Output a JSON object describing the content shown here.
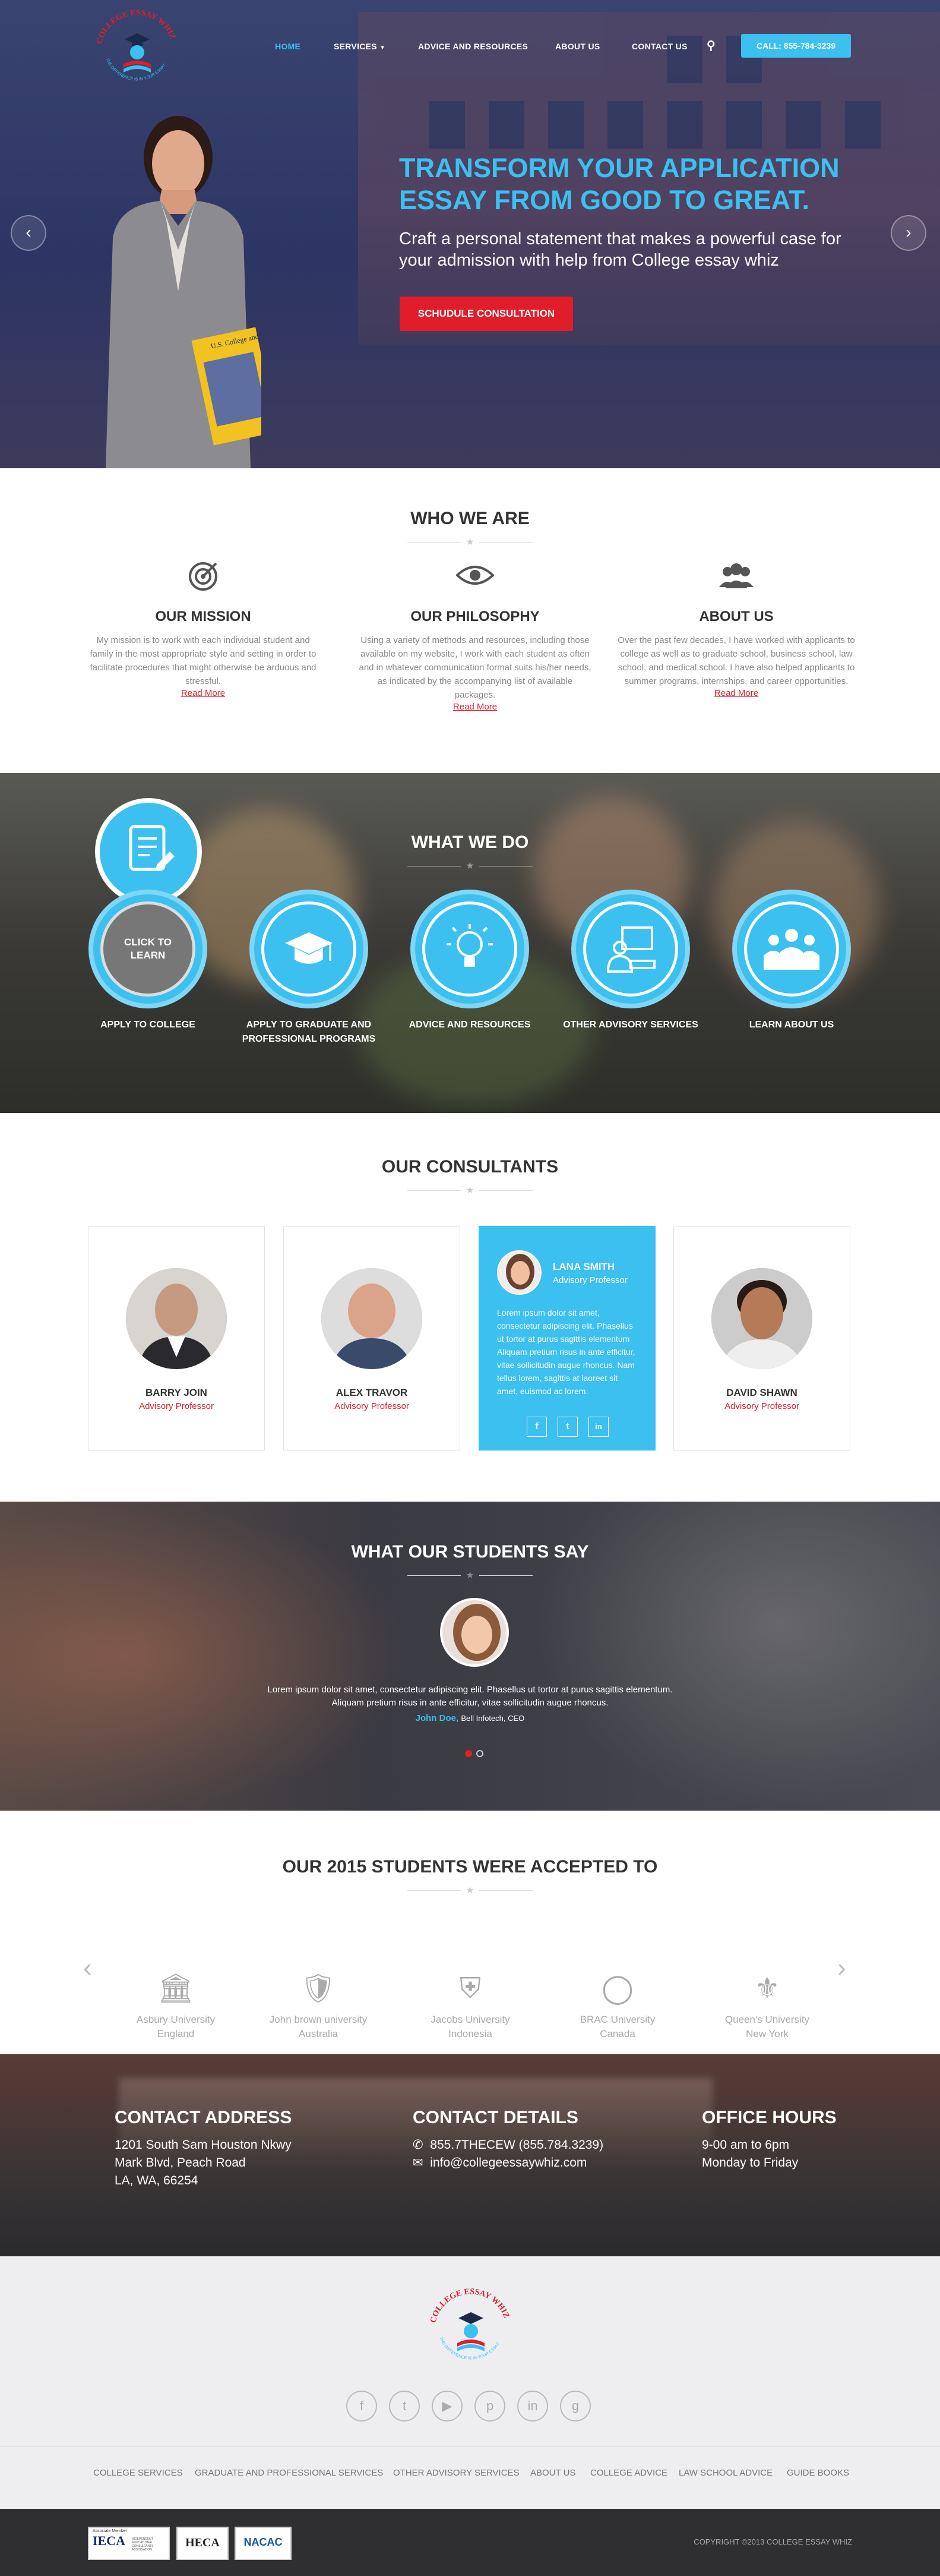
{
  "brand": {
    "logo_text": "COLLEGE ESSAY WHIZ",
    "logo_tagline": "THE DIFFERENCE IS IN YOUR ESSAY",
    "accent": "#3bc0f0",
    "red": "#e11d2a"
  },
  "nav": {
    "home": "HOME",
    "services": "SERVICES",
    "advice": "ADVICE AND RESOURCES",
    "about": "ABOUT US",
    "contact": "CONTACT US",
    "call": "CALL: 855-784-3239"
  },
  "hero": {
    "title": "TRANSFORM YOUR APPLICATION ESSAY FROM GOOD TO GREAT.",
    "subtitle": "Craft a personal statement that makes a powerful case for your admission with help from College essay whiz",
    "button": "SCHUDULE  CONSULTATION",
    "book": "U.S. College and University"
  },
  "who": {
    "title": "WHO WE ARE",
    "read_more": "Read More",
    "cols": [
      {
        "title": "OUR MISSION",
        "text": "My mission is to work with each individual student and family in the most appropriate style and setting in order to facilitate procedures that might otherwise be arduous and stressful."
      },
      {
        "title": "OUR PHILOSOPHY",
        "text": "Using a variety of methods and resources, including those available on my website, I work with each student as often and in whatever communication format suits his/her needs, as indicated by the accompanying list of available packages."
      },
      {
        "title": "ABOUT US",
        "text": "Over the past few decades, I have worked with applicants to college as well as to graduate school, business school, law school, and medical school.  I have also helped applicants to summer programs, internships, and career opportunities."
      }
    ]
  },
  "what": {
    "title": "WHAT WE DO",
    "click": "CLICK TO LEARN",
    "items": [
      {
        "label": "APPLY TO COLLEGE"
      },
      {
        "label": "APPLY TO GRADUATE AND PROFESSIONAL PROGRAMS"
      },
      {
        "label": "ADVICE AND RESOURCES"
      },
      {
        "label": "OTHER ADVISORY SERVICES"
      },
      {
        "label": "LEARN ABOUT US"
      }
    ]
  },
  "consultants": {
    "title": "OUR CONSULTANTS",
    "people": [
      {
        "name": "BARRY JOIN",
        "role": "Advisory Professor"
      },
      {
        "name": "ALEX TRAVOR",
        "role": "Advisory Professor"
      },
      {
        "name": "LANA SMITH",
        "role": "Advisory Professor",
        "bio": "Lorem ipsum dolor sit amet, consectetur adipiscing elit. Phasellus ut tortor at purus sagittis elementum Aliquam pretium risus in ante efficitur, vitae sollicitudin augue rhoncus. Nam tellus lorem, sagittis at laoreet sit amet, euismod ac lorem."
      },
      {
        "name": "DAVID SHAWN",
        "role": "Advisory Professor"
      }
    ]
  },
  "testimonial": {
    "title": "WHAT OUR STUDENTS SAY",
    "quote": "Lorem ipsum dolor sit amet, consectetur adipiscing elit. Phasellus ut tortor at purus sagittis elementum. Aliquam pretium risus in ante efficitur, vitae sollicitudin augue rhoncus.",
    "author": "John Doe,",
    "company": "Bell Infotech, CEO"
  },
  "accepted": {
    "title": "OUR 2015 STUDENTS WERE ACCEPTED TO",
    "unis": [
      {
        "name": "Asbury University",
        "place": "England"
      },
      {
        "name": "John brown university",
        "place": "Australia"
      },
      {
        "name": "Jacobs University",
        "place": "Indonesia"
      },
      {
        "name": "BRAC University",
        "place": "Canada"
      },
      {
        "name": "Queen's University",
        "place": "New York"
      }
    ]
  },
  "contact": {
    "address_title": "CONTACT ADDRESS",
    "address": [
      "1201 South Sam Houston Nkwy",
      "Mark Blvd, Peach Road",
      "LA, WA, 66254"
    ],
    "details_title": "CONTACT DETAILS",
    "phone": "855.7THECEW (855.784.3239)",
    "email": "info@collegeessaywhiz.com",
    "hours_title": "OFFICE HOURS",
    "hours": [
      "9-00 am to 6pm",
      "Monday to Friday"
    ]
  },
  "footer_links": [
    "COLLEGE SERVICES",
    "GRADUATE AND PROFESSIONAL SERVICES",
    "OTHER ADVISORY SERVICES",
    "ABOUT US",
    "COLLEGE ADVICE",
    "LAW SCHOOL ADVICE",
    "GUIDE BOOKS"
  ],
  "copyright": "COPYRIGHT ©2013 COLLEGE ESSAY WHIZ",
  "badges": [
    "IECA",
    "HECA",
    "NACAC"
  ],
  "badge_sub": {
    "ieca": "Associate Member",
    "ieca_text": "INDEPENDENT EDUCATIONAL CONSULTANTS ASSOCIATION"
  }
}
